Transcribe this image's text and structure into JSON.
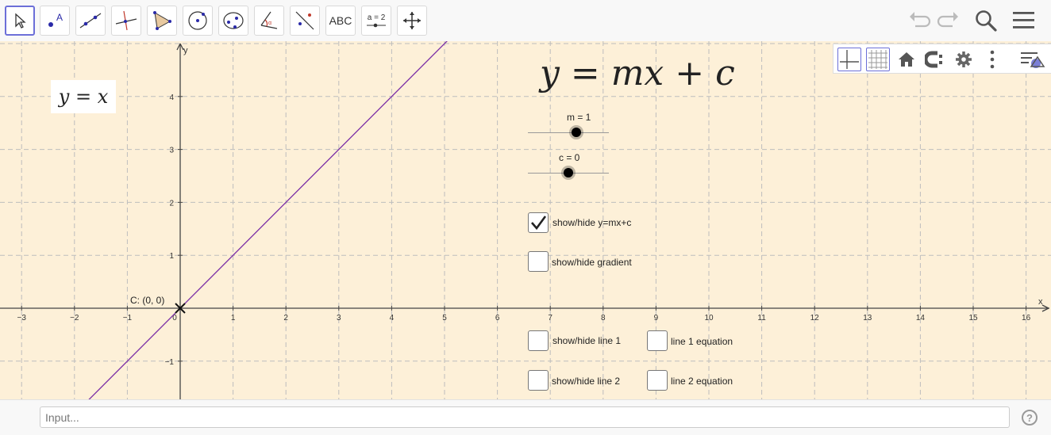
{
  "toolbar": {
    "tools": [
      {
        "name": "move-tool",
        "icon": "arrow-pointer-icon"
      },
      {
        "name": "point-tool",
        "icon": "point-icon"
      },
      {
        "name": "line-tool",
        "icon": "line-through-points-icon"
      },
      {
        "name": "perpendicular-tool",
        "icon": "perpendicular-line-icon"
      },
      {
        "name": "polygon-tool",
        "icon": "polygon-icon"
      },
      {
        "name": "circle-tool",
        "icon": "circle-center-point-icon"
      },
      {
        "name": "conic-tool",
        "icon": "ellipse-icon"
      },
      {
        "name": "angle-tool",
        "icon": "angle-icon"
      },
      {
        "name": "reflect-tool",
        "icon": "reflect-about-line-icon"
      },
      {
        "name": "text-tool",
        "label": "ABC"
      },
      {
        "name": "slider-tool",
        "label": "a = 2"
      },
      {
        "name": "move-view-tool",
        "icon": "move-arrows-icon"
      }
    ],
    "right_icons": [
      "undo-icon",
      "redo-icon",
      "search-icon",
      "menu-icon"
    ]
  },
  "style_bar": {
    "buttons": [
      "show-axes-icon",
      "show-grid-icon",
      "standard-view-icon",
      "point-capturing-icon",
      "settings-gear-icon",
      "more-vertical-icon",
      "toggle-style-bar-icon"
    ]
  },
  "graphics": {
    "formula_box": "y = x",
    "title_formula": "y = mx + c",
    "axis_x_label": "x",
    "axis_y_label": "y",
    "x_ticks": [
      "−3",
      "−2",
      "−1",
      "0",
      "1",
      "2",
      "3",
      "4",
      "5",
      "6",
      "7",
      "8",
      "9",
      "10",
      "11",
      "12",
      "13",
      "14",
      "15",
      "16"
    ],
    "y_ticks": [
      "4",
      "3",
      "2",
      "1",
      "−1"
    ],
    "point_label": "C: (0, 0)",
    "line_color": "#7b2fa6"
  },
  "sliders": [
    {
      "label": "m = 1",
      "value": 1,
      "min": -5,
      "max": 5
    },
    {
      "label": "c = 0",
      "value": 0,
      "min": -5,
      "max": 5
    }
  ],
  "checkboxes": [
    {
      "label": "show/hide y=mx+c",
      "checked": true
    },
    {
      "label": "show/hide gradient",
      "checked": false
    },
    {
      "label": "show/hide line 1",
      "checked": false
    },
    {
      "label": "line 1 equation",
      "checked": false
    },
    {
      "label": "show/hide line 2",
      "checked": false
    },
    {
      "label": "line 2 equation",
      "checked": false
    }
  ],
  "input_bar": {
    "placeholder": "Input...",
    "help_icon": "?"
  }
}
